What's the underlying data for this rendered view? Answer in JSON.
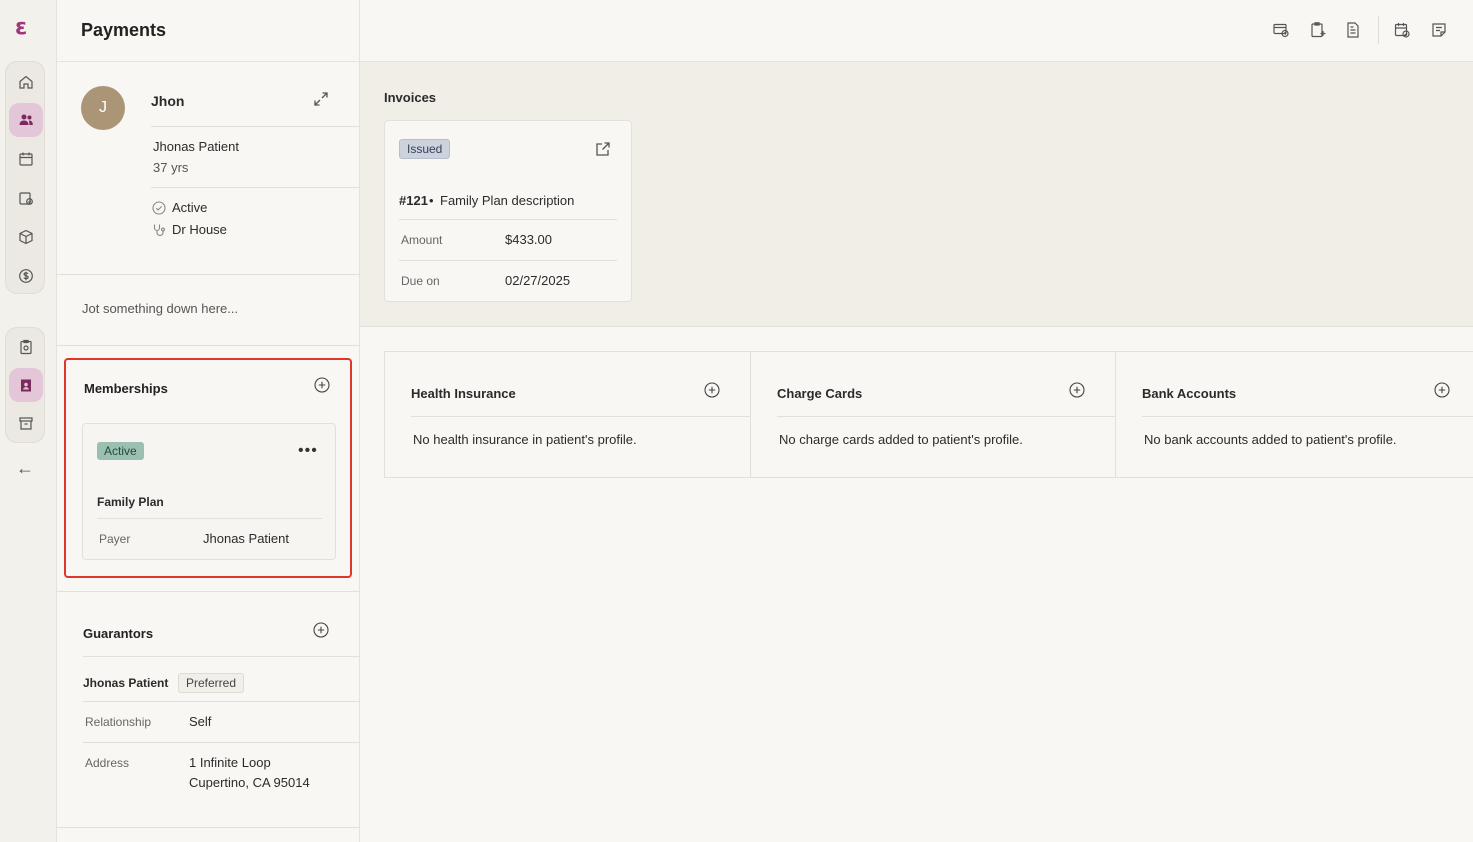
{
  "header": {
    "title": "Payments"
  },
  "patient": {
    "initial": "J",
    "name": "Jhon",
    "full_name": "Jhonas Patient",
    "age": "37 yrs",
    "status": "Active",
    "doctor": "Dr House",
    "note_placeholder": "Jot something down here..."
  },
  "memberships": {
    "title": "Memberships",
    "badge": "Active",
    "plan": "Family Plan",
    "payer_label": "Payer",
    "payer_value": "Jhonas Patient"
  },
  "guarantors": {
    "title": "Guarantors",
    "name": "Jhonas Patient",
    "badge": "Preferred",
    "relationship_label": "Relationship",
    "relationship_value": "Self",
    "address_label": "Address",
    "address_line1": "1 Infinite Loop",
    "address_line2": "Cupertino, CA 95014"
  },
  "invoices": {
    "title": "Invoices",
    "badge": "Issued",
    "number": "#121",
    "description": "Family Plan description",
    "amount_label": "Amount",
    "amount_value": "$433.00",
    "due_label": "Due on",
    "due_value": "02/27/2025"
  },
  "accounts": [
    {
      "title": "Health Insurance",
      "empty": "No health insurance in patient's profile."
    },
    {
      "title": "Charge Cards",
      "empty": "No charge cards added to patient's profile."
    },
    {
      "title": "Bank Accounts",
      "empty": "No bank accounts added to patient's profile."
    }
  ],
  "colors": {
    "accent": "#a0357a",
    "highlight_border": "#e0362c",
    "active_badge": "#9bc0b1",
    "issued_badge": "#cdd2dc"
  }
}
